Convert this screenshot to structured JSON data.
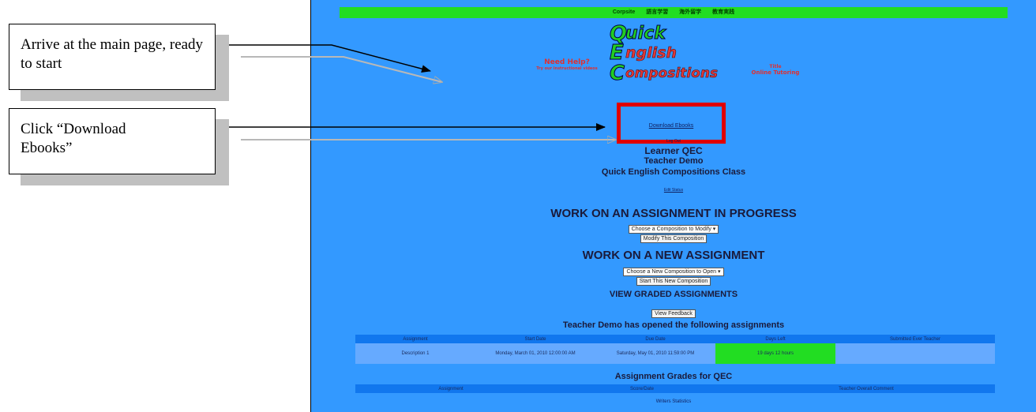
{
  "callouts": [
    {
      "text": "Arrive at the main page, ready to start"
    },
    {
      "text": "Click “Download Ebooks”"
    }
  ],
  "screen": {
    "topbar": [
      "Corpsite",
      "語言学習",
      "海外留学",
      "教育実践"
    ],
    "logo": {
      "q_letter": "Q",
      "q_rest": "uick",
      "e_letter": "E",
      "e_rest": "nglish",
      "c_letter": "C",
      "c_rest": "ompositions",
      "left_tag_1": "Need Help?",
      "left_tag_2": "Try our instructional videos",
      "right_tag_1": "Title",
      "right_tag_2": "Online Tutoring"
    },
    "download_link": "Download Ebooks",
    "logout_link": "Log Out",
    "learner_name": "Learner  QEC",
    "teacher_name": "Teacher Demo",
    "class_name": "Quick English Compositions  Class",
    "edit_status": "Edit Status",
    "progress_heading": "WORK ON AN ASSIGNMENT IN PROGRESS",
    "progress_select": "Choose a Composition to Modify",
    "progress_button": "Modify This Composition",
    "new_heading": "WORK ON A NEW ASSIGNMENT",
    "new_select": "Choose a New Composition to Open",
    "new_button": "Start This New Composition",
    "graded_heading": "VIEW GRADED ASSIGNMENTS",
    "graded_button": "View Feedback",
    "opened_heading": "Teacher Demo  has opened the following assignments",
    "assign_table": {
      "headers": [
        "Assignment",
        "Start Date",
        "Due Date",
        "Days Left",
        "Submitted Ever Teacher"
      ],
      "rows": [
        [
          "Description 1",
          "Monday, March 01, 2010 12:00:00 AM",
          "Saturday, May 01, 2010 11:59:00 PM",
          "19 days 12 hours",
          ""
        ]
      ]
    },
    "grades_heading": "Assignment Grades for QEC",
    "grades_table": {
      "headers": [
        "Assignment",
        "Score/Date",
        "Teacher Overall Comment"
      ]
    },
    "stats_link": "Writers Statistics"
  }
}
